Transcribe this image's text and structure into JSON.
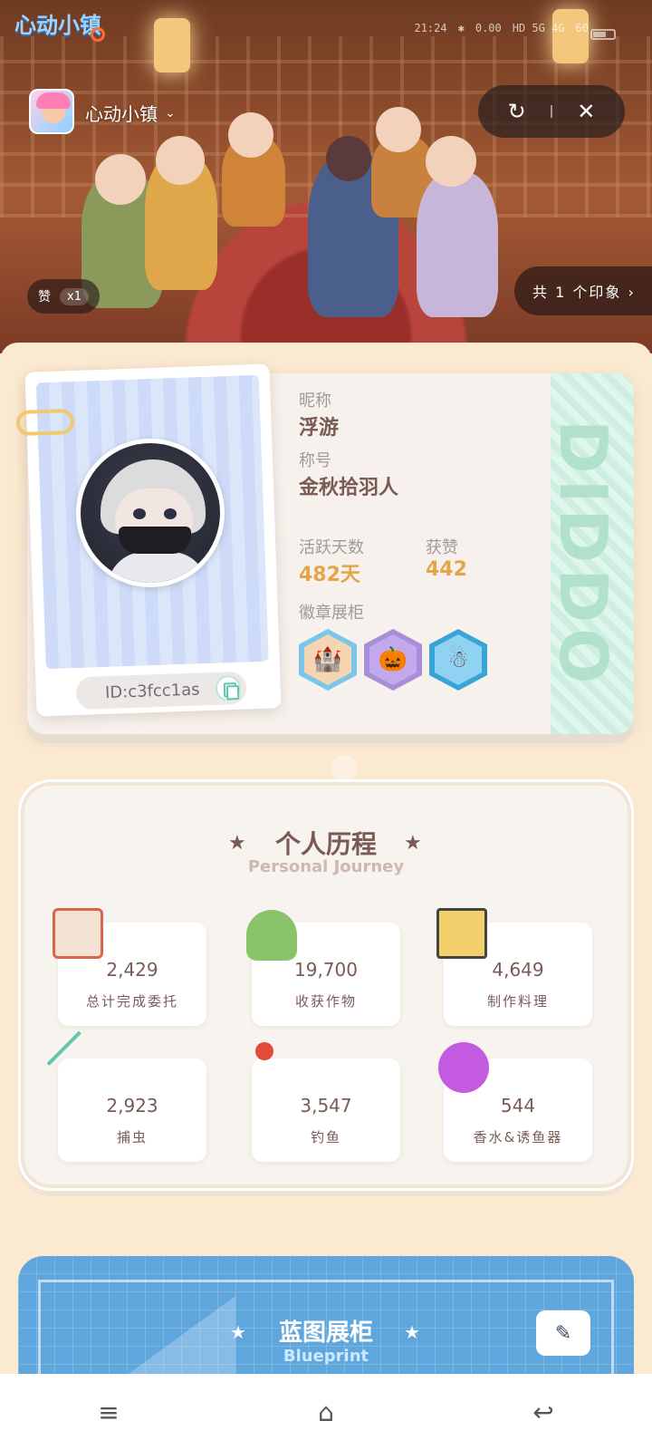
{
  "status": {
    "logo": "心动小镇",
    "time": "21:24",
    "speed": "0.00",
    "network": "HD 5G 4G",
    "battery": "60"
  },
  "header": {
    "app_name": "心动小镇",
    "share_icon": "share-icon",
    "more_icon": "more-icon",
    "close_icon": "close-icon",
    "like_label": "赞",
    "like_count": "x1",
    "impression_label": "共 1 个印象 ›"
  },
  "profile": {
    "nickname_label": "昵称",
    "nickname": "浮游",
    "title_label": "称号",
    "title": "金秋拾羽人",
    "active_days_label": "活跃天数",
    "active_days": "482天",
    "likes_label": "获赞",
    "likes": "442",
    "badges_label": "徽章展柜",
    "id": "ID:c3fcc1as",
    "tab_text": "DIDDO",
    "badges": [
      "sandcastle-badge",
      "pumpkin-badge",
      "snowman-badge"
    ]
  },
  "journey": {
    "title": "个人历程",
    "subtitle": "Personal Journey",
    "items": [
      {
        "value": "2,429",
        "label": "总计完成委托",
        "icon": "calendar-icon"
      },
      {
        "value": "19,700",
        "label": "收获作物",
        "icon": "watering-can-icon"
      },
      {
        "value": "4,649",
        "label": "制作料理",
        "icon": "stove-icon"
      },
      {
        "value": "2,923",
        "label": "捕虫",
        "icon": "bug-net-icon"
      },
      {
        "value": "3,547",
        "label": "钓鱼",
        "icon": "fishing-rod-icon"
      },
      {
        "value": "544",
        "label": "香水&诱鱼器",
        "icon": "perfume-icon"
      }
    ]
  },
  "blueprint": {
    "title": "蓝图展柜",
    "subtitle": "Blueprint",
    "edit_icon": "edit-icon"
  },
  "nav": {
    "menu_icon": "menu-icon",
    "home_icon": "home-icon",
    "back_icon": "back-icon"
  }
}
